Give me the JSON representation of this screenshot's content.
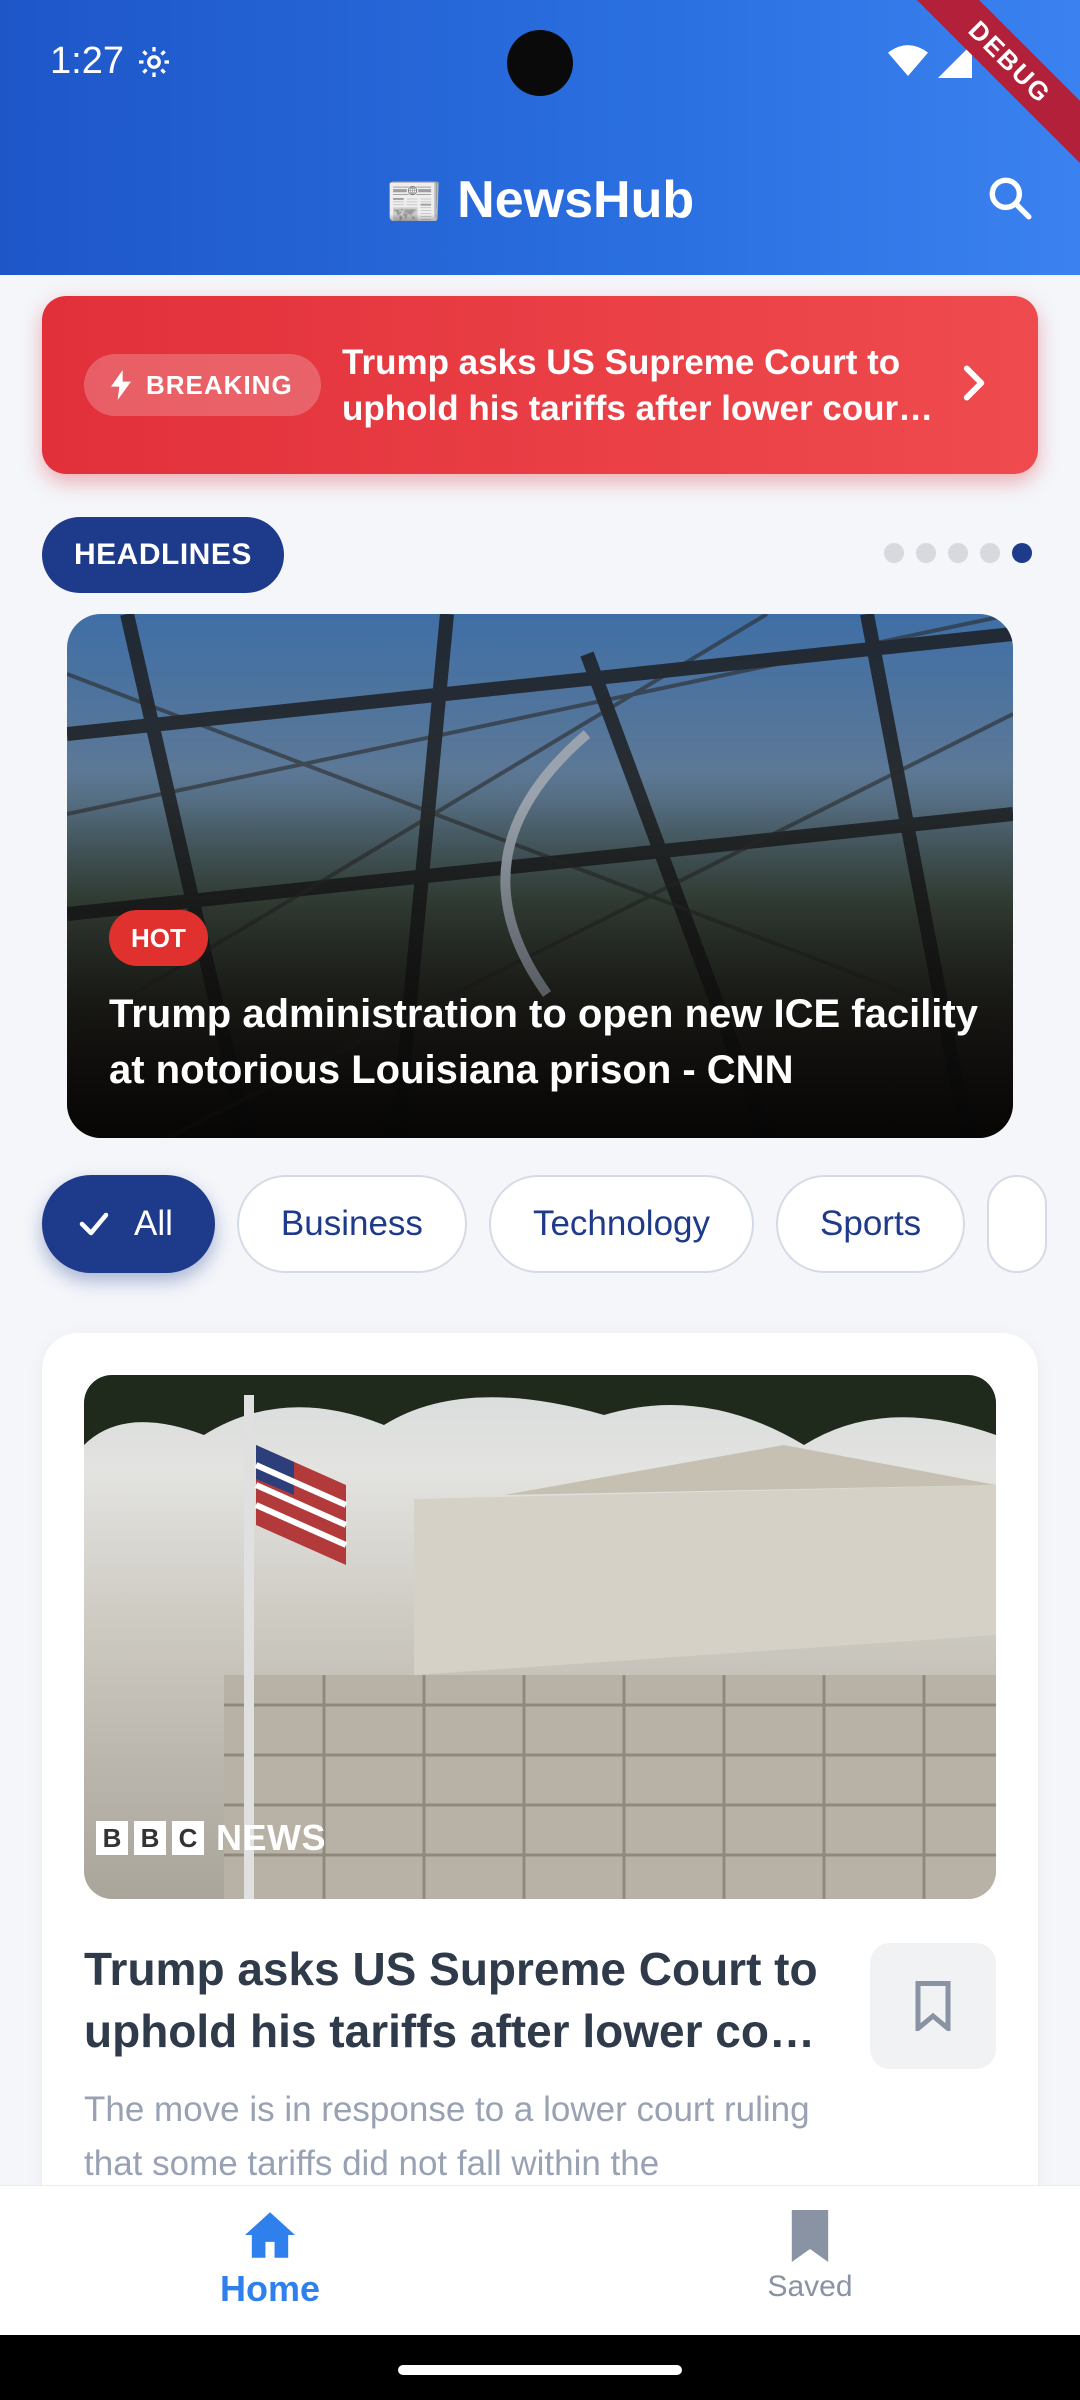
{
  "status_bar": {
    "time": "1:27",
    "debug_label": "DEBUG"
  },
  "app": {
    "emoji": "📰",
    "title": "NewsHub"
  },
  "breaking": {
    "label": "BREAKING",
    "headline": "Trump asks US Supreme Court to uphold his tariffs after lower court ruling"
  },
  "headlines": {
    "label": "HEADLINES",
    "dot_count": 5,
    "active_dot": 5,
    "hero": {
      "badge": "HOT",
      "title": "Trump administration to open new ICE facility at notorious Louisiana prison - CNN"
    }
  },
  "categories": [
    {
      "label": "All",
      "selected": true
    },
    {
      "label": "Business",
      "selected": false
    },
    {
      "label": "Technology",
      "selected": false
    },
    {
      "label": "Sports",
      "selected": false
    }
  ],
  "article": {
    "source_letters": [
      "B",
      "B",
      "C"
    ],
    "source_word": "NEWS",
    "title": "Trump asks US Supreme Court to uphold his tariffs after lower court ruling",
    "description": "The move is in response to a lower court ruling that some tariffs did not fall within the"
  },
  "bottom_nav": {
    "home": "Home",
    "saved": "Saved"
  },
  "colors": {
    "primary": "#1e3a8a",
    "header_gradient_start": "#1e56c8",
    "breaking_red": "#e2303a",
    "nav_active": "#2f80ed"
  }
}
